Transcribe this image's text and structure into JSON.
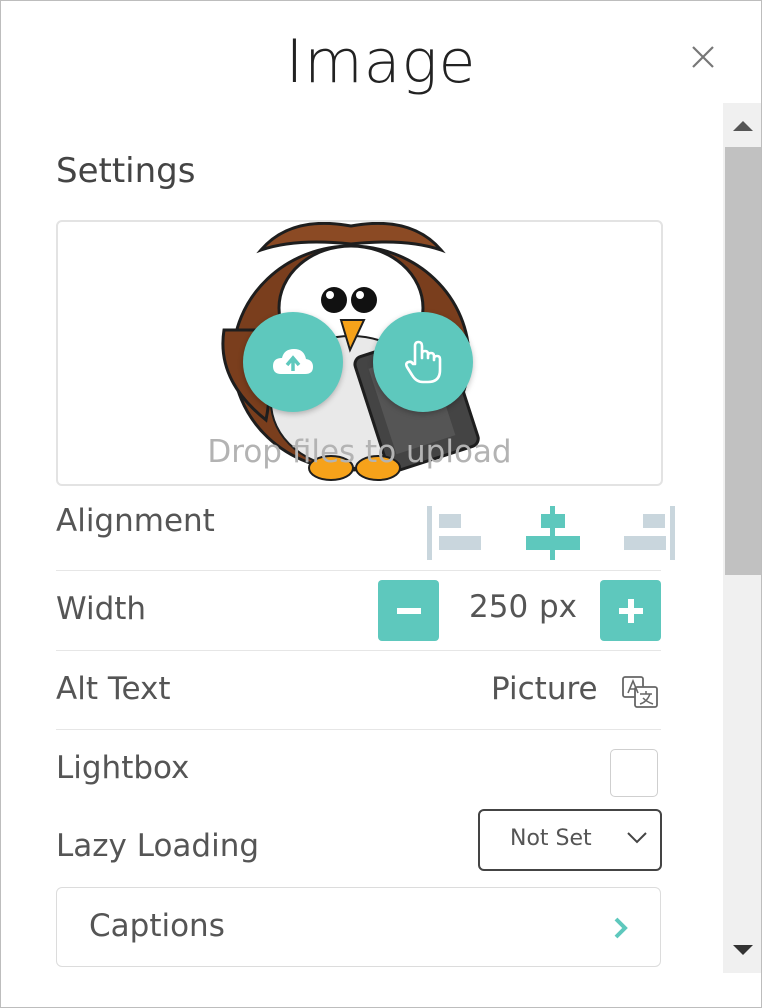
{
  "dialog": {
    "title": "Image",
    "close_icon": "close-icon"
  },
  "settings": {
    "heading": "Settings",
    "dropzone": {
      "text": "Drop files to upload",
      "upload_icon": "cloud-upload-icon",
      "select_icon": "hand-pointer-icon"
    },
    "alignment": {
      "label": "Alignment",
      "options": [
        "align-left-icon",
        "align-center-icon",
        "align-right-icon"
      ],
      "selected": "align-center-icon"
    },
    "width": {
      "label": "Width",
      "value": "250",
      "unit": "px",
      "decrement_icon": "minus-icon",
      "increment_icon": "plus-icon"
    },
    "alt_text": {
      "label": "Alt Text",
      "value": "Picture",
      "icon": "translate-icon"
    },
    "lightbox": {
      "label": "Lightbox",
      "checked": false
    },
    "lazy_loading": {
      "label": "Lazy Loading",
      "selected": "Not Set"
    },
    "captions": {
      "label": "Captions",
      "icon": "chevron-right-icon"
    }
  },
  "colors": {
    "accent": "#5ec8bd",
    "inactive": "#c9d6dd"
  }
}
